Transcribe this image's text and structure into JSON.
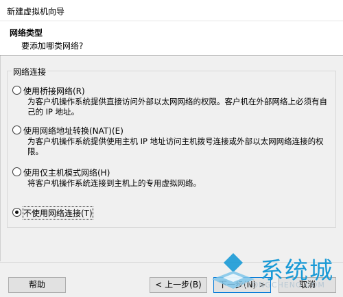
{
  "window": {
    "title": "新建虚拟机向导"
  },
  "header": {
    "title": "网络类型",
    "subtitle": "要添加哪类网络?"
  },
  "group": {
    "label": "网络连接"
  },
  "options": [
    {
      "label": "使用桥接网络(R)",
      "desc": "为客户机操作系统提供直接访问外部以太网网络的权限。客户机在外部网络上必须有自己的 IP 地址。",
      "checked": false
    },
    {
      "label": "使用网络地址转换(NAT)(E)",
      "desc": "为客户机操作系统提供使用主机 IP 地址访问主机拨号连接或外部以太网网络连接的权限。",
      "checked": false
    },
    {
      "label": "使用仅主机模式网络(H)",
      "desc": "将客户机操作系统连接到主机上的专用虚拟网络。",
      "checked": false
    },
    {
      "label": "不使用网络连接(T)",
      "desc": "",
      "checked": true
    }
  ],
  "buttons": {
    "help": "帮助",
    "back": "< 上一步(B)",
    "next": "下一步(N) >",
    "cancel": "取消"
  },
  "watermark": {
    "text": "系统城",
    "url": "XITONGCHENG.COM",
    "colors": {
      "brand": "#1a9ad6"
    }
  }
}
